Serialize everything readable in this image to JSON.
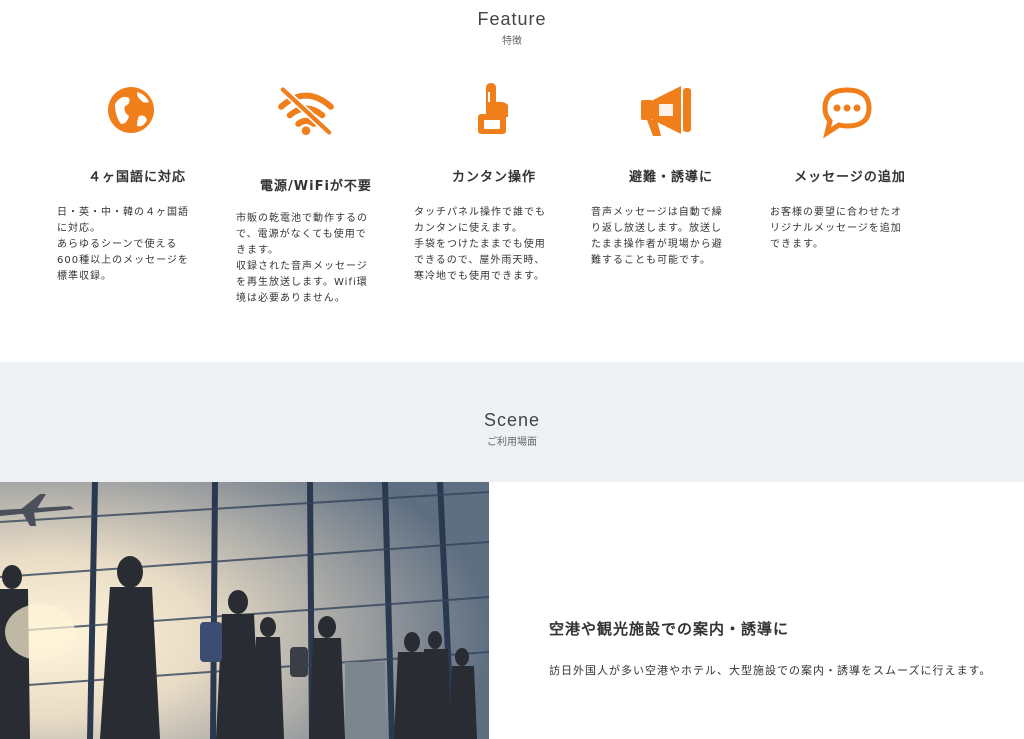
{
  "feature": {
    "title_en": "Feature",
    "title_ja": "特徴",
    "accent_color": "#f07e1a",
    "items": [
      {
        "icon": "globe-icon",
        "heading": "４ヶ国語に対応",
        "lines": [
          "日・英・中・韓の４ヶ国語",
          "に対応。",
          "あらゆるシーンで使える",
          "600種以上のメッセージを",
          "標準収録。"
        ]
      },
      {
        "icon": "no-wifi-icon",
        "heading": "電源/WiFiが不要",
        "lines": [
          "市販の乾電池で動作するの",
          "で、電源がなくても使用で",
          "きます。",
          "収録された音声メッセージ",
          "を再生放送します。Wifi環",
          "境は必要ありません。"
        ]
      },
      {
        "icon": "touch-hand-icon",
        "heading": "カンタン操作",
        "lines": [
          "タッチパネル操作で誰でも",
          "カンタンに使えます。",
          "手袋をつけたままでも使用",
          "できるので、屋外雨天時、",
          "寒冷地でも使用できます。"
        ]
      },
      {
        "icon": "megaphone-icon",
        "heading": "避難・誘導に",
        "lines": [
          "音声メッセージは自動で繰",
          "り返し放送します。放送し",
          "たまま操作者が現場から避",
          "難することも可能です。"
        ]
      },
      {
        "icon": "speech-bubble-icon",
        "heading": "メッセージの追加",
        "lines": [
          "お客様の要望に合わせたオ",
          "リジナルメッセージを追加",
          "できます。"
        ]
      }
    ]
  },
  "scene": {
    "title_en": "Scene",
    "title_ja": "ご利用場面",
    "band_color": "#eef1f4",
    "heading": "空港や観光施設での案内・誘導に",
    "text": "訪日外国人が多い空港やホテル、大型施設での案内・誘導をスムーズに行えます。"
  }
}
